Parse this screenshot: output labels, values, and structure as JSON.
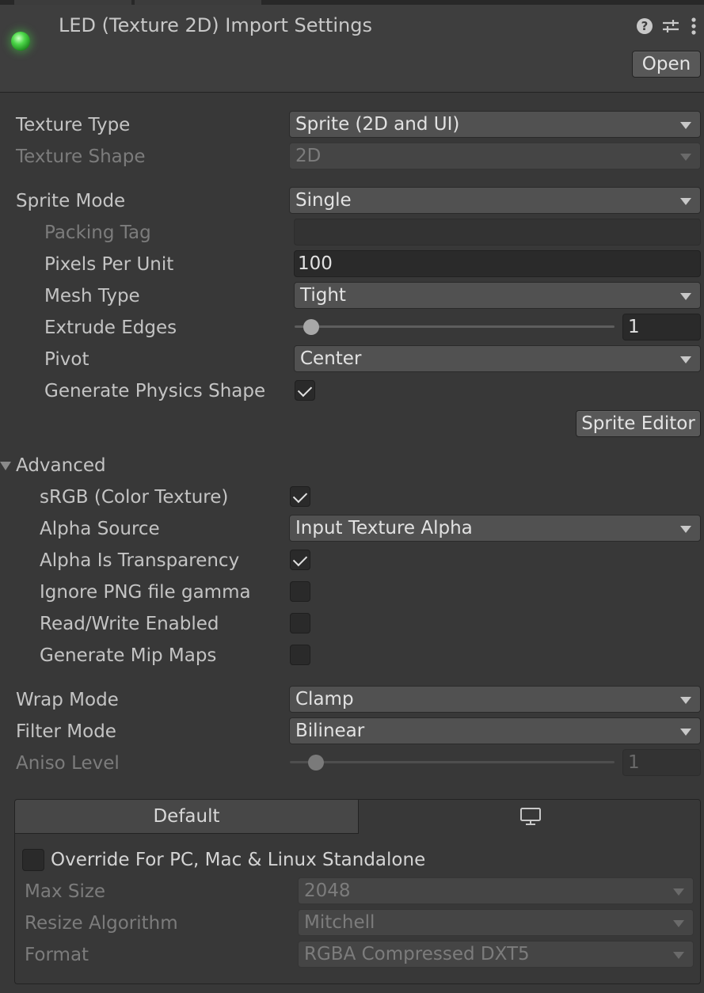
{
  "header": {
    "title": "LED (Texture 2D) Import Settings",
    "open_button": "Open",
    "icons": [
      "help-icon",
      "preset-sliders-icon",
      "kebab-menu-icon"
    ]
  },
  "fields": {
    "texture_type": {
      "label": "Texture Type",
      "value": "Sprite (2D and UI)"
    },
    "texture_shape": {
      "label": "Texture Shape",
      "value": "2D"
    },
    "sprite_mode": {
      "label": "Sprite Mode",
      "value": "Single"
    },
    "packing_tag": {
      "label": "Packing Tag",
      "value": ""
    },
    "pixels_per_unit": {
      "label": "Pixels Per Unit",
      "value": "100"
    },
    "mesh_type": {
      "label": "Mesh Type",
      "value": "Tight"
    },
    "extrude_edges": {
      "label": "Extrude Edges",
      "value": "1"
    },
    "pivot": {
      "label": "Pivot",
      "value": "Center"
    },
    "generate_physics_shape": {
      "label": "Generate Physics Shape",
      "checked": true
    },
    "sprite_editor_button": "Sprite Editor"
  },
  "advanced": {
    "label": "Advanced",
    "srgb": {
      "label": "sRGB (Color Texture)",
      "checked": true
    },
    "alpha_source": {
      "label": "Alpha Source",
      "value": "Input Texture Alpha"
    },
    "alpha_is_transparency": {
      "label": "Alpha Is Transparency",
      "checked": true
    },
    "ignore_png_gamma": {
      "label": "Ignore PNG file gamma",
      "checked": false
    },
    "read_write": {
      "label": "Read/Write Enabled",
      "checked": false
    },
    "generate_mip_maps": {
      "label": "Generate Mip Maps",
      "checked": false
    }
  },
  "sampling": {
    "wrap_mode": {
      "label": "Wrap Mode",
      "value": "Clamp"
    },
    "filter_mode": {
      "label": "Filter Mode",
      "value": "Bilinear"
    },
    "aniso_level": {
      "label": "Aniso Level",
      "value": "1"
    }
  },
  "platform": {
    "tab_default": "Default",
    "tab_pc_icon": "monitor-icon",
    "override": {
      "label": "Override For PC, Mac & Linux Standalone",
      "checked": false
    },
    "max_size": {
      "label": "Max Size",
      "value": "2048"
    },
    "resize_algorithm": {
      "label": "Resize Algorithm",
      "value": "Mitchell"
    },
    "format": {
      "label": "Format",
      "value": "RGBA Compressed DXT5"
    }
  },
  "colors": {
    "background": "#383838",
    "header": "#3e3e3e",
    "led_green": "#4ed84a"
  }
}
